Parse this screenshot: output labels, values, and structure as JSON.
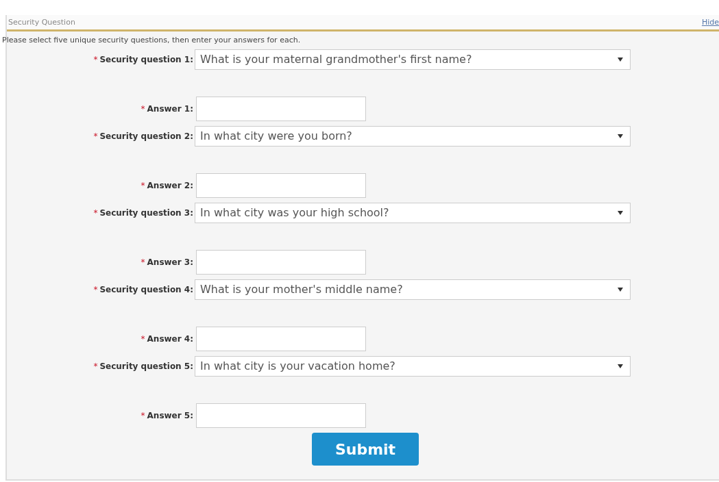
{
  "panel": {
    "title": "Security Question",
    "hide_link": "Hide"
  },
  "instructions": "Please select five unique security questions, then enter your answers for each.",
  "pairs": [
    {
      "question_label": "Security question 1:",
      "question_marker": "*",
      "question": "What is your maternal grandmother's first name?",
      "answer_label": "Answer 1:",
      "answer_marker": "*"
    },
    {
      "question_label": "Security question 2:",
      "question_marker": "*",
      "question": "In what city were you born?",
      "answer_label": "Answer 2:",
      "answer_marker": "*"
    },
    {
      "question_label": "Security question 3:",
      "question_marker": "*",
      "question": "In what city was your high school?",
      "answer_label": "Answer 3:",
      "answer_marker": "*"
    },
    {
      "question_label": "Security question 4:",
      "question_marker": "*",
      "question": "What is your mother's middle name?",
      "answer_label": "Answer 4:",
      "answer_marker": "*"
    },
    {
      "question_label": "Security question 5:",
      "question_marker": "*",
      "question": "In what city is your vacation home?",
      "answer_label": "Answer 5:",
      "answer_marker": "*"
    }
  ],
  "submit": "Submit"
}
